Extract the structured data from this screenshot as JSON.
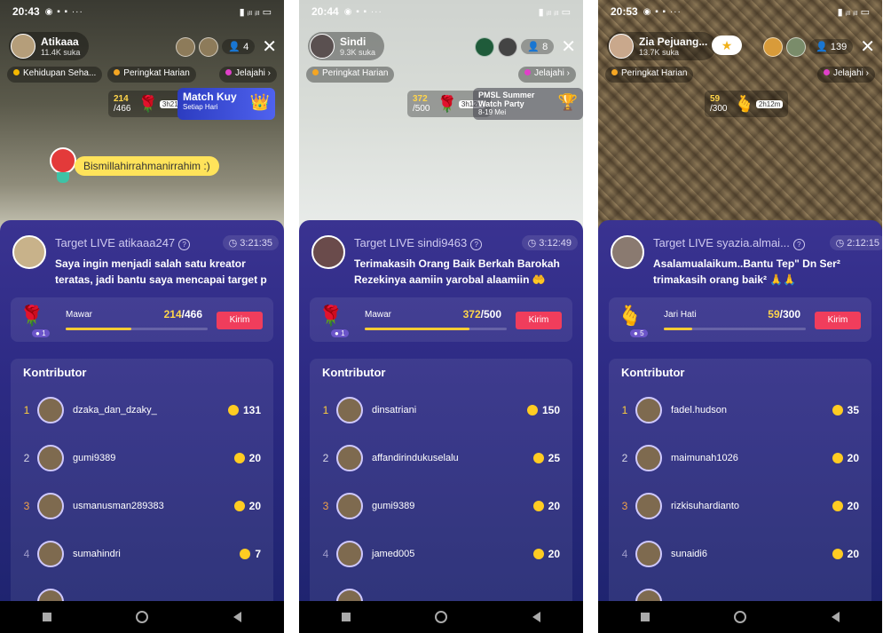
{
  "colors": {
    "panel": "#2c2a83",
    "accent_send": "#f03d5c",
    "coin": "#ffcc22",
    "progress": "#ffcc33"
  },
  "phones": [
    {
      "status_time": "20:43",
      "host": {
        "name": "Atikaaa",
        "likes": "11.4K suka"
      },
      "viewers": "4",
      "chips": [
        "Kehidupan Seha...",
        "Peringkat Harian",
        "Jelajahi"
      ],
      "goal": {
        "count": "214",
        "total": "/466",
        "time": "3h21m"
      },
      "promo": {
        "title": "Match Kuy",
        "sub": "Setiap Hari"
      },
      "comment": "Bismillahirrahmanirrahim :)",
      "target_title": "Target LIVE atikaaa247",
      "timer": "3:21:35",
      "target_message": "Saya ingin menjadi salah satu kreator teratas, jadi bantu saya mencapai target p",
      "gift": {
        "name": "Mawar",
        "current": "214",
        "total": "/466",
        "progress": 0.46,
        "coin_count": "1",
        "send": "Kirim",
        "icon": "rose-icon"
      },
      "contributors_title": "Kontributor",
      "contributors": [
        {
          "rank": "1",
          "name": "dzaka_dan_dzaky_",
          "value": "131"
        },
        {
          "rank": "2",
          "name": "gumi9389",
          "value": "20"
        },
        {
          "rank": "3",
          "name": "usmanusman289383",
          "value": "20"
        },
        {
          "rank": "4",
          "name": "sumahindri",
          "value": "7"
        }
      ]
    },
    {
      "status_time": "20:44",
      "host": {
        "name": "Sindi",
        "likes": "9.3K suka"
      },
      "viewers": "8",
      "chips": [
        "Peringkat Harian",
        "Jelajahi"
      ],
      "goal": {
        "count": "372",
        "total": "/500",
        "time": "3h12m"
      },
      "promo": {
        "title": "PMSL Summer Watch Party",
        "sub": "8-19 Mei"
      },
      "comment": "",
      "target_title": "Target LIVE sindi9463",
      "timer": "3:12:49",
      "target_message": "Terimakasih Orang Baik Berkah Barokah Rezekinya aamiin yarobal alaamiin 🤲",
      "gift": {
        "name": "Mawar",
        "current": "372",
        "total": "/500",
        "progress": 0.74,
        "coin_count": "1",
        "send": "Kirim",
        "icon": "rose-icon"
      },
      "contributors_title": "Kontributor",
      "contributors": [
        {
          "rank": "1",
          "name": "dinsatriani",
          "value": "150"
        },
        {
          "rank": "2",
          "name": "affandirindukuselalu",
          "value": "25"
        },
        {
          "rank": "3",
          "name": "gumi9389",
          "value": "20"
        },
        {
          "rank": "4",
          "name": "jamed005",
          "value": "20"
        }
      ]
    },
    {
      "status_time": "20:53",
      "host": {
        "name": "Zia Pejuang...",
        "likes": "13.7K suka"
      },
      "viewers": "139",
      "chips": [
        "Peringkat Harian",
        "Jelajahi"
      ],
      "goal": {
        "count": "59",
        "total": "/300",
        "time": "2h12m"
      },
      "promo": {
        "title": "",
        "sub": ""
      },
      "comment": "",
      "target_title": "Target LIVE syazia.almai...",
      "timer": "2:12:15",
      "target_message": "Asalamualaikum..Bantu Tep\" Dn Ser² trimakasih orang baik² 🙏🙏",
      "gift": {
        "name": "Jari Hati",
        "current": "59",
        "total": "/300",
        "progress": 0.2,
        "coin_count": "5",
        "send": "Kirim",
        "icon": "finger-heart-icon"
      },
      "contributors_title": "Kontributor",
      "contributors": [
        {
          "rank": "1",
          "name": "fadel.hudson",
          "value": "35"
        },
        {
          "rank": "2",
          "name": "maimunah1026",
          "value": "20"
        },
        {
          "rank": "3",
          "name": "rizkisuhardianto",
          "value": "20"
        },
        {
          "rank": "4",
          "name": "sunaidi6",
          "value": "20"
        }
      ]
    }
  ]
}
